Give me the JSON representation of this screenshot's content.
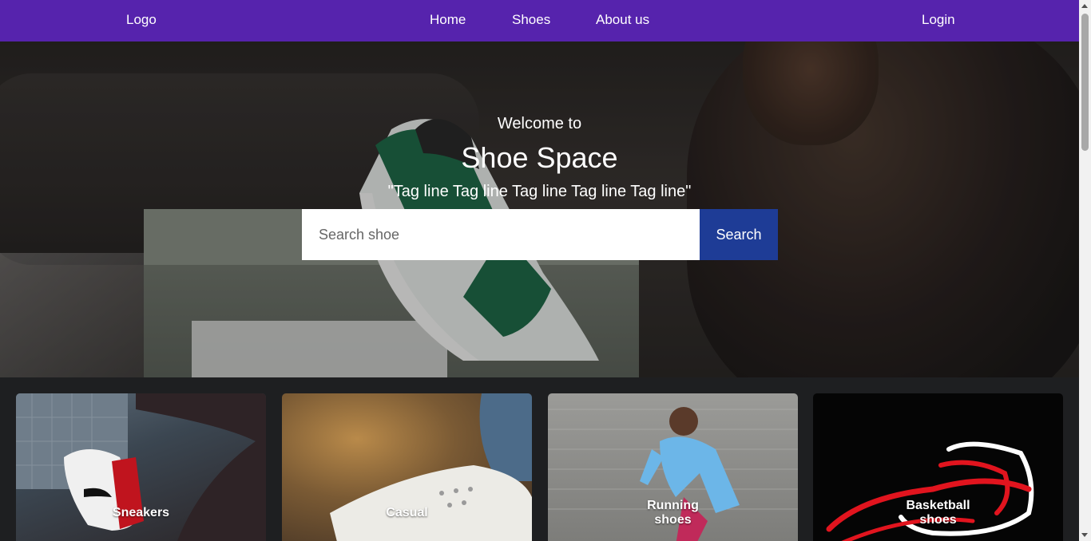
{
  "navbar": {
    "logo": "Logo",
    "links": [
      "Home",
      "Shoes",
      "About us"
    ],
    "login": "Login",
    "background": "#5623ad"
  },
  "hero": {
    "welcome": "Welcome to",
    "title": "Shoe Space",
    "tagline": "\"Tag line Tag line Tag line Tag line Tag line\"",
    "search": {
      "placeholder": "Search shoe",
      "button_label": "Search",
      "button_color": "#1e3c96"
    }
  },
  "categories": [
    {
      "label": "Sneakers"
    },
    {
      "label": "Casual"
    },
    {
      "label": "Running shoes"
    },
    {
      "label": "Basketball shoes"
    }
  ]
}
